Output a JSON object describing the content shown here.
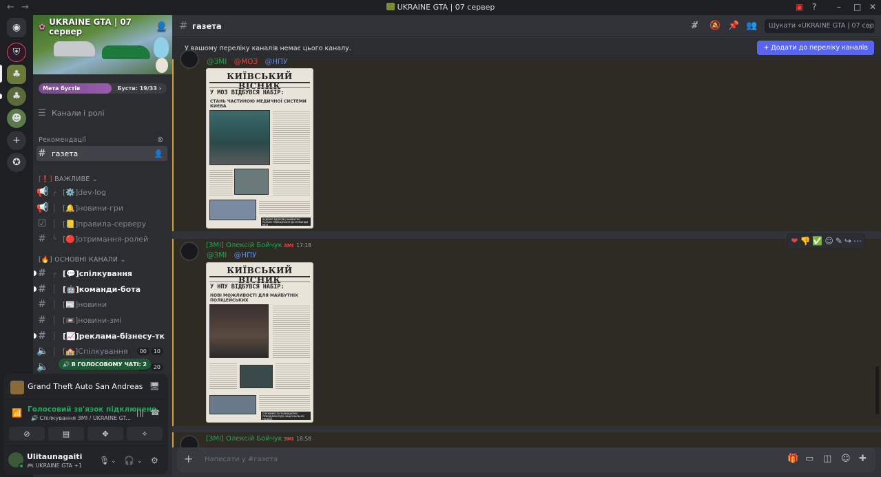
{
  "window": {
    "title": "UKRAINE GTA | 07 сервер",
    "back": "←",
    "forward": "→"
  },
  "server": {
    "name": "UKRAINE GTA | 07 сервер",
    "boost_goal_label": "Мета бустів",
    "boost_count": "Бусти: 19/33 ›",
    "boost_progress": 0.57
  },
  "sidebar": {
    "channels_roles": "Канали і ролі",
    "recommendations": "Рекомендації",
    "active_channel": "газета",
    "category_important": "ВАЖЛИВЕ",
    "category_important_emoji": "[❗]",
    "category_main": "ОСНОВНІ КАНАЛИ",
    "category_main_emoji": "[🔥]",
    "channels": [
      {
        "name": "dev-log",
        "prefix": "[⚙️]"
      },
      {
        "name": "новини-гри",
        "prefix": "[🔔]"
      },
      {
        "name": "правила-серверу",
        "prefix": "[📒]"
      },
      {
        "name": "отримання-ролей",
        "prefix": "[🔴]"
      },
      {
        "name": "спілкування",
        "prefix": "[💬]"
      },
      {
        "name": "команди-бота",
        "prefix": "[🤖]"
      },
      {
        "name": "новини",
        "prefix": "[📰]"
      },
      {
        "name": "новини-змі",
        "prefix": "[📼]"
      },
      {
        "name": "реклама-бізнесу-тк",
        "prefix": "[📈]"
      },
      {
        "name": "Спілкування",
        "prefix": "[🏫]"
      }
    ],
    "voice_badge_1": [
      "00",
      "10"
    ],
    "voice_badge_2": [
      "00",
      "20"
    ],
    "voice_tooltip": "🔊 В ГОЛОСОВОМУ ЧАТІ: 2"
  },
  "panel": {
    "game": "Grand Theft Auto San Andreas",
    "voice_status": "Голосовий зв'язок підключено",
    "voice_channel": "🔊 Спілкування ЗМІ / UKRAINE GT...",
    "username": "Ulitaunagaiti",
    "user_status": "🎮 UKRAINE GTA +1"
  },
  "header": {
    "channel": "газета",
    "search_placeholder": "Шукати «UKRAINE GTA | 07 сер...",
    "notice": "У вашому переліку каналів немає цього каналу.",
    "add_button": "+  Додати до переліку каналів"
  },
  "messages": [
    {
      "mentions": [
        "@ЗМІ",
        "@МОЗ",
        "@НПУ"
      ],
      "paper": {
        "masthead": "КИЇВСЬКИЙ ВІСНИК",
        "headline": "У МОЗ ВІДБУВСЯ НАБІР:",
        "subhead": "СТАНЬ ЧАСТИНОЮ МЕДИЧНОЇ СИСТЕМИ КИЄВА",
        "footer": "БУДЕМО ЗДОРОВІ! МАЙБУТНЄ РАЗОМ! ПРИЄДНУЙСЯ ДО КОМАНДИ МОЗ"
      }
    },
    {
      "author": "[ЗМІ] Олексій Бойчук",
      "tag": "ЗМІ",
      "time": "17:18",
      "mentions": [
        "@ЗМІ",
        "@НПУ"
      ],
      "paper": {
        "masthead": "КИЇВСЬКИЙ ВІСНИК",
        "headline": "У НПУ ВІДБУВСЯ НАБІР:",
        "subhead": "НОВІ МОЖЛИВОСТІ ДЛЯ МАЙБУТНІХ ПОЛІЦЕЙСЬКИХ",
        "footer": "СЛУЖИМО ТА ЗАХИЩАЄМО! ПРИЄДНУЙСЯ ДО НАЦІОНАЛЬНОЇ ПОЛІЦІЇ"
      }
    },
    {
      "author": "[ЗМІ] Олексій Бойчук",
      "tag": "ЗМІ",
      "time": "18:58"
    }
  ],
  "composer": {
    "placeholder": "Написати у #газета"
  },
  "colors": {
    "accent": "#5865f2",
    "online": "#23a55a",
    "mention_zmi": "#23a55a",
    "mention_moz": "#ed4245",
    "mention_npu": "#5b8def"
  }
}
